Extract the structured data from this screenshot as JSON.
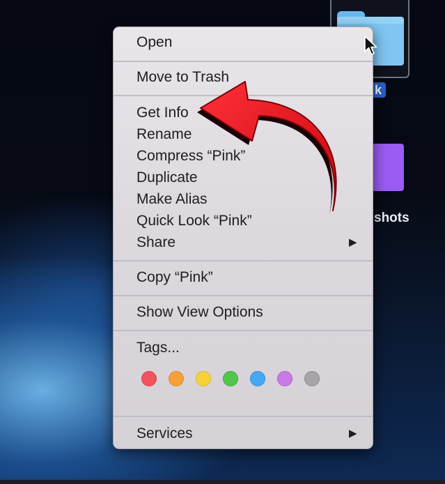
{
  "desktop": {
    "folder1_label": "k",
    "folder2_label": "shots"
  },
  "menu": {
    "items": [
      {
        "label": "Open"
      },
      {
        "label": "Move to Trash"
      },
      {
        "label": "Get Info"
      },
      {
        "label": "Rename"
      },
      {
        "label": "Compress “Pink”"
      },
      {
        "label": "Duplicate"
      },
      {
        "label": "Make Alias"
      },
      {
        "label": "Quick Look “Pink”"
      },
      {
        "label": "Share"
      },
      {
        "label": "Copy “Pink”"
      },
      {
        "label": "Show View Options"
      },
      {
        "label": "Tags..."
      },
      {
        "label": "Services"
      }
    ],
    "submenu_glyph": "▶",
    "tag_colors": [
      {
        "name": "red",
        "hex": "#f2545b"
      },
      {
        "name": "orange",
        "hex": "#f6a03b"
      },
      {
        "name": "yellow",
        "hex": "#f6d13a"
      },
      {
        "name": "green",
        "hex": "#52c64a"
      },
      {
        "name": "blue",
        "hex": "#45a8f4"
      },
      {
        "name": "purple",
        "hex": "#c97ae6"
      },
      {
        "name": "gray",
        "hex": "#a7a5a8"
      }
    ]
  },
  "annotation_color": "#e8141c"
}
